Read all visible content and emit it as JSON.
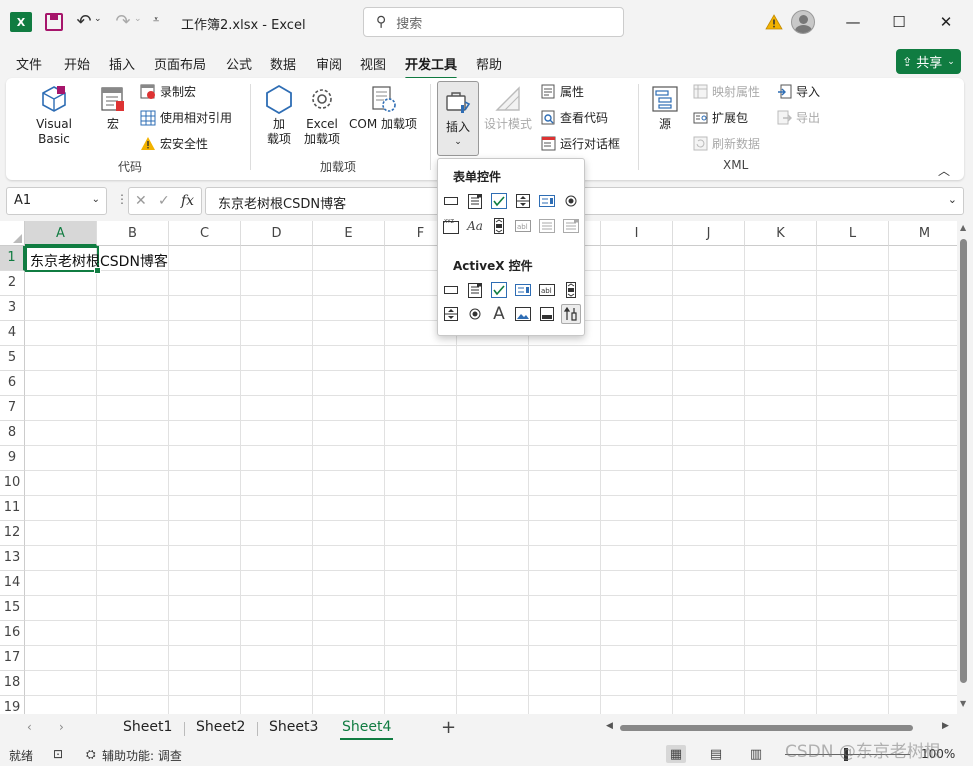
{
  "titlebar": {
    "app_badge": "X",
    "doc_title": "工作簿2.xlsx  -  Excel",
    "search_placeholder": "搜索"
  },
  "tabs": [
    "文件",
    "开始",
    "插入",
    "页面布局",
    "公式",
    "数据",
    "审阅",
    "视图",
    "开发工具",
    "帮助"
  ],
  "active_tab": "开发工具",
  "share_label": "共享",
  "ribbon": {
    "code": {
      "visual_basic": "Visual Basic",
      "macros": "宏",
      "record_macro": "录制宏",
      "relative_refs": "使用相对引用",
      "macro_security": "宏安全性",
      "group_label": "代码"
    },
    "addins": {
      "addin": [
        "加",
        "载项"
      ],
      "excel_addins": [
        "Excel",
        "加载项"
      ],
      "com_addins": "COM 加载项",
      "group_label": "加载项"
    },
    "controls": {
      "insert": "插入",
      "design_mode": "设计模式",
      "properties": "属性",
      "view_code": "查看代码",
      "run_dialog": "运行对话框"
    },
    "xml": {
      "source": "源",
      "map_properties": "映射属性",
      "expansion_packs": "扩展包",
      "refresh_data": "刷新数据",
      "import": "导入",
      "export": "导出",
      "group_label": "XML"
    }
  },
  "formula_bar": {
    "name_box": "A1",
    "fx": "fx",
    "content": "东京老树根CSDN博客"
  },
  "grid": {
    "columns": [
      "A",
      "B",
      "C",
      "D",
      "E",
      "F",
      "G",
      "H",
      "I",
      "J",
      "K",
      "L",
      "M"
    ],
    "rows": [
      "1",
      "2",
      "3",
      "4",
      "5",
      "6",
      "7",
      "8",
      "9",
      "10",
      "11",
      "12",
      "13",
      "14",
      "15",
      "16",
      "17",
      "18",
      "19"
    ],
    "a1_value": "东京老树根CSDN博客"
  },
  "insert_dropdown": {
    "form_controls_title": "表单控件",
    "activex_title": "ActiveX 控件",
    "form_controls": [
      "button",
      "combo-box",
      "check-box",
      "spin-button",
      "list-box",
      "option-button",
      "group-box",
      "label",
      "scroll-bar",
      "text-field",
      "combo-list-edit",
      "combo-dropdown-edit"
    ],
    "activex_controls": [
      "command-button",
      "combo-box",
      "check-box",
      "list-box",
      "text-box",
      "scroll-bar",
      "spin-button",
      "option-button",
      "label",
      "image",
      "toggle-button",
      "more-controls"
    ]
  },
  "sheets": [
    "Sheet1",
    "Sheet2",
    "Sheet3",
    "Sheet4"
  ],
  "active_sheet": "Sheet4",
  "status": {
    "ready": "就绪",
    "accessibility": "辅助功能: 调查",
    "zoom": "100%"
  },
  "watermark": "CSDN @东京老树根",
  "colors": {
    "accent": "#107c41",
    "macro_purple": "#a6156b",
    "warning": "#f2b200"
  }
}
